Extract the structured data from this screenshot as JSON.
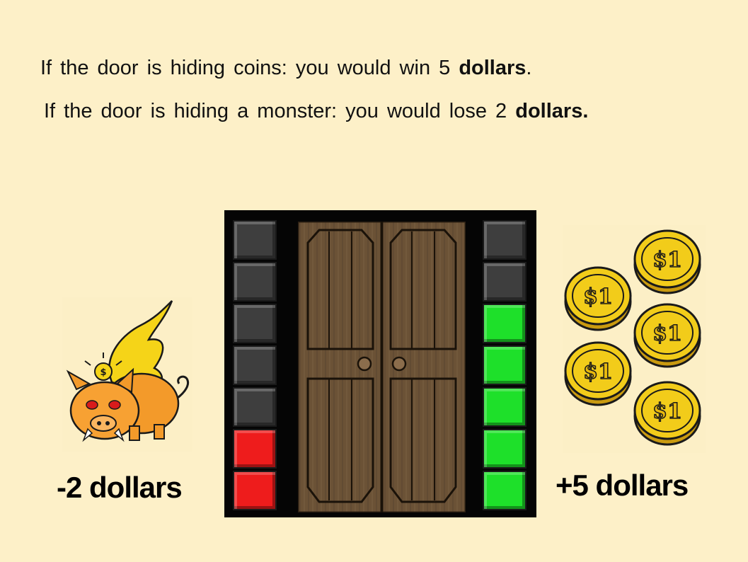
{
  "instructions": {
    "line1_prefix": "If the door is hiding coins: you would win 5 ",
    "line1_bold": "dollars",
    "line1_suffix": ".",
    "line2_prefix": "If the door is hiding a monster: you would lose 2 ",
    "line2_bold": "dollars."
  },
  "outcomes": {
    "loss_label": "-2 dollars",
    "gain_label": "+5 dollars"
  },
  "coin_text": "$1",
  "bars": {
    "left": [
      "gray",
      "gray",
      "gray",
      "gray",
      "gray",
      "red",
      "red"
    ],
    "right": [
      "gray",
      "gray",
      "green",
      "green",
      "green",
      "green",
      "green"
    ]
  },
  "colors": {
    "background": "#fdf0c8",
    "red": "#ee1c1c",
    "green": "#1ee02a",
    "gray": "#3e3e3e",
    "door_wood": "#6b5236",
    "coin_gold": "#f2cc1a"
  }
}
